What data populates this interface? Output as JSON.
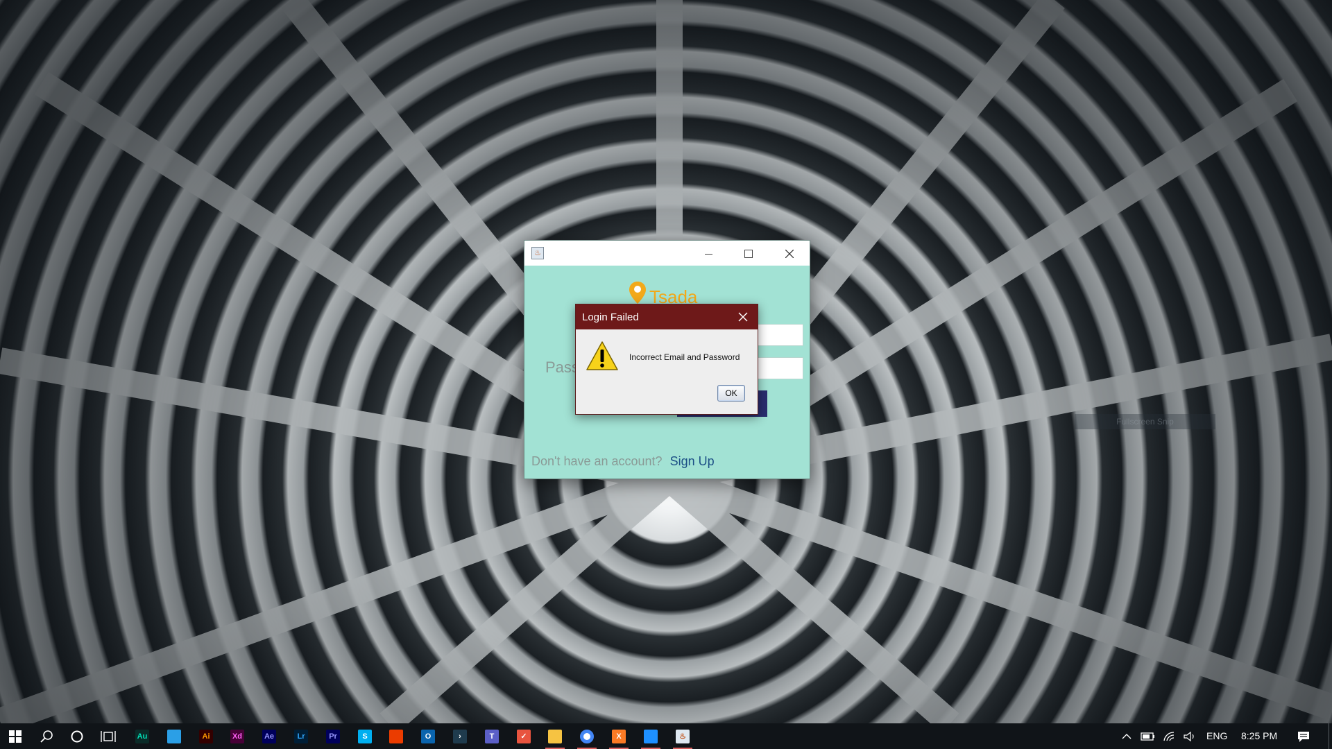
{
  "desktop": {
    "ghost_box_text": "Fullscreen Snip"
  },
  "login_window": {
    "title": "",
    "logo_text": "Tsada",
    "password_label": "Pass",
    "signup_prompt": "Don't have an account?",
    "signup_link": "Sign Up"
  },
  "dialog": {
    "title": "Login Failed",
    "message": "Incorrect Email and Password",
    "ok_label": "OK"
  },
  "taskbar": {
    "apps": [
      {
        "name": "Audition",
        "abbr": "Au",
        "color": "#00e4bb",
        "bg": "#0b2b28",
        "running": false
      },
      {
        "name": "Mail",
        "abbr": "",
        "color": "#2b9fe6",
        "bg": "#2b9fe6",
        "running": false
      },
      {
        "name": "Illustrator",
        "abbr": "Ai",
        "color": "#ff9a00",
        "bg": "#330000",
        "running": false
      },
      {
        "name": "Adobe XD",
        "abbr": "Xd",
        "color": "#ff61f6",
        "bg": "#470137",
        "running": false
      },
      {
        "name": "After Effects",
        "abbr": "Ae",
        "color": "#9999ff",
        "bg": "#00005b",
        "running": false
      },
      {
        "name": "Lightroom",
        "abbr": "Lr",
        "color": "#31a8ff",
        "bg": "#001e36",
        "running": false
      },
      {
        "name": "Premiere Pro",
        "abbr": "Pr",
        "color": "#9999ff",
        "bg": "#00005b",
        "running": false
      },
      {
        "name": "Skype",
        "abbr": "S",
        "color": "#ffffff",
        "bg": "#00aff0",
        "running": false
      },
      {
        "name": "Office",
        "abbr": "",
        "color": "#eb3c00",
        "bg": "#eb3c00",
        "running": false
      },
      {
        "name": "Outlook",
        "abbr": "O",
        "color": "#ffffff",
        "bg": "#0a64ad",
        "running": false
      },
      {
        "name": "PowerShell",
        "abbr": "›",
        "color": "#ffffff",
        "bg": "#1f3b4d",
        "running": false
      },
      {
        "name": "Teams",
        "abbr": "T",
        "color": "#ffffff",
        "bg": "#5b5fc7",
        "running": false
      },
      {
        "name": "TickTick",
        "abbr": "✓",
        "color": "#ffffff",
        "bg": "#e8543f",
        "running": false
      },
      {
        "name": "File Explorer",
        "abbr": "",
        "color": "#f6c342",
        "bg": "#f6c342",
        "running": true
      },
      {
        "name": "Chrome",
        "abbr": "",
        "color": "#4285f4",
        "bg": "#ffffff",
        "running": true
      },
      {
        "name": "XAMPP",
        "abbr": "X",
        "color": "#ffffff",
        "bg": "#fb7a24",
        "running": true
      },
      {
        "name": "Messenger",
        "abbr": "",
        "color": "#ffffff",
        "bg": "#1e90ff",
        "running": true
      },
      {
        "name": "Java App",
        "abbr": "♨",
        "color": "#c2561f",
        "bg": "#dfe8f1",
        "running": true
      }
    ],
    "tray": {
      "language": "ENG",
      "time": "8:25 PM"
    }
  }
}
